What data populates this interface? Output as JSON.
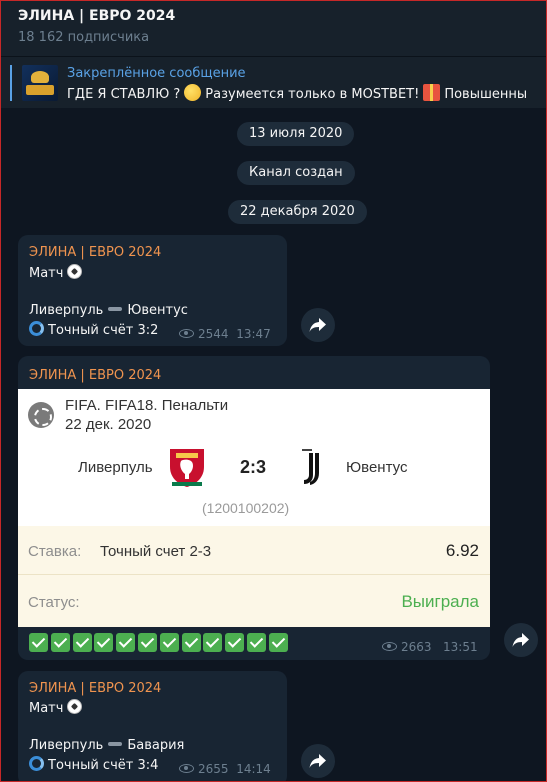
{
  "header": {
    "title": "ЭЛИНА | ЕВРО 2024",
    "subscribers": "18 162 подписчика"
  },
  "pinned": {
    "label": "Закреплённое сообщение",
    "text_part1": "ГДЕ Я СТАВЛЮ ?",
    "text_part2": "Разумеется только в MOSTBET!",
    "text_part3": "Повышенны"
  },
  "dates": {
    "d1": "13 июля 2020",
    "d2": "Канал создан",
    "d3": "22 декабря 2020"
  },
  "messages": [
    {
      "author": "ЭЛИНА | ЕВРО 2024",
      "title": "Матч",
      "team_home": "Ливерпуль",
      "team_away": "Ювентус",
      "prediction": "Точный счёт 3:2",
      "views": "2544",
      "time": "13:47"
    },
    {
      "author": "ЭЛИНА | ЕВРО 2024",
      "card": {
        "league": "FIFA. FIFA18. Пенальти",
        "date": "22 дек. 2020",
        "team_home": "Ливерпуль",
        "score": "2:3",
        "team_away": "Ювентус",
        "event_id": "(1200100202)",
        "stake_label": "Ставка:",
        "stake_value": "Точный счет 2-3",
        "odds": "6.92",
        "status_label": "Статус:",
        "status_value": "Выиграла",
        "status_color": "#4caf50"
      },
      "check_count": 12,
      "views": "2663",
      "time": "13:51"
    },
    {
      "author": "ЭЛИНА | ЕВРО 2024",
      "title": "Матч",
      "team_home": "Ливерпуль",
      "team_away": "Бавария",
      "prediction": "Точный счёт 3:4",
      "views": "2655",
      "time": "14:14"
    }
  ],
  "colors": {
    "background": "#0e1621",
    "bubble": "#182533",
    "author": "#f0944f",
    "accent": "#5aa2e6"
  }
}
